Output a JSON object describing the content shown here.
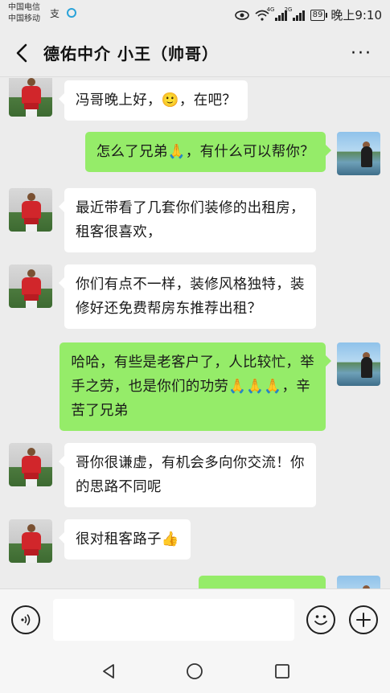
{
  "status_bar": {
    "carrier_1": "中国电信",
    "carrier_2": "中国移动",
    "network_1": "4G",
    "network_2": "2G",
    "battery": "89",
    "time": "晚上9:10"
  },
  "header": {
    "title": "德佑中介 小王（帅哥）",
    "more_label": "···"
  },
  "messages": [
    {
      "side": "in",
      "text": "冯哥晚上好，🙂，在吧？"
    },
    {
      "side": "out",
      "text": "怎么了兄弟🙏，有什么可以帮你？"
    },
    {
      "side": "in",
      "text": "最近带看了几套你们装修的出租房，租客很喜欢，",
      "line1": "最近带看了几套你们装修的出租房，",
      "line2": "租客很喜欢，"
    },
    {
      "side": "in",
      "text": "你们有点不一样，装修风格独特，装修好还免费帮房东推荐出租？",
      "line1": "你们有点不一样，装修风格独特，装",
      "line2": "修好还免费帮房东推荐出租？"
    },
    {
      "side": "out",
      "text": "哈哈，有些是老客户了，人比较忙，举手之劳，也是你们的功劳🙏🙏🙏，辛苦了兄弟",
      "line1": "哈哈，有些是老客户了，人比较忙，举",
      "line2": "手之劳，也是你们的功劳🙏🙏🙏，辛",
      "line3": "苦了兄弟"
    },
    {
      "side": "in",
      "text": "哥你很谦虚，有机会多向你交流！你的思路不同呢",
      "line1": "哥你很谦虚，有机会多向你交流！你",
      "line2": "的思路不同呢"
    },
    {
      "side": "in",
      "text": "很对租客路子👍"
    }
  ],
  "input": {
    "value": "",
    "placeholder": ""
  },
  "icons": {
    "back": "chevron-left-icon",
    "more": "more-dots-icon",
    "voice": "voice-icon",
    "emoji": "emoji-icon",
    "plus": "plus-icon",
    "nav_back": "triangle-back-icon",
    "nav_home": "circle-home-icon",
    "nav_recent": "square-recent-icon"
  },
  "colors": {
    "outgoing_bubble": "#95ec69",
    "incoming_bubble": "#ffffff",
    "chat_background": "#ececec"
  }
}
